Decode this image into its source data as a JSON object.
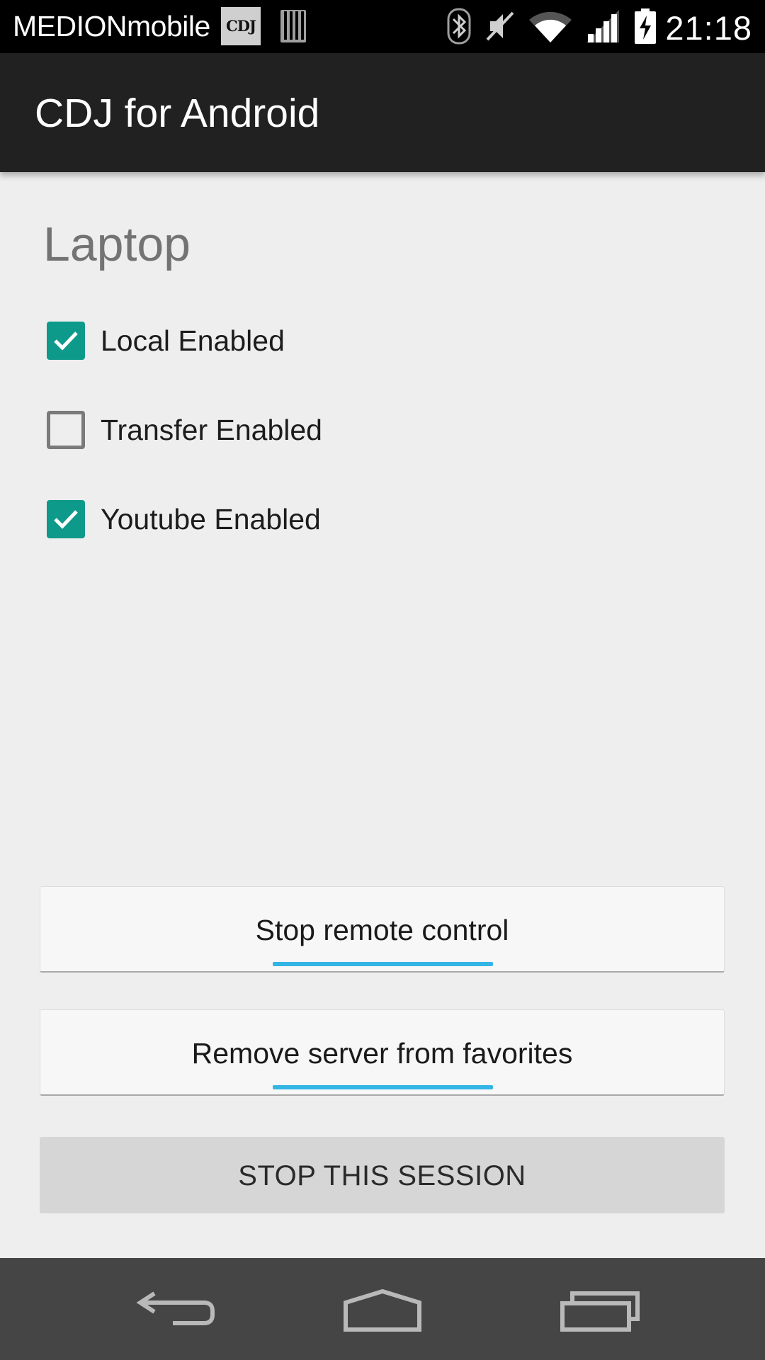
{
  "status_bar": {
    "carrier": "MEDIONmobile",
    "app_notification_icon_text": "CDJ",
    "time": "21:18",
    "icons": [
      "app-notification-icon",
      "sd-card-icon",
      "bluetooth-icon",
      "muted-icon",
      "wifi-icon",
      "cell-signal-icon",
      "battery-charging-icon"
    ]
  },
  "action_bar": {
    "title": "CDJ for Android"
  },
  "main": {
    "section_title": "Laptop",
    "options": [
      {
        "label": "Local Enabled",
        "checked": true
      },
      {
        "label": "Transfer Enabled",
        "checked": false
      },
      {
        "label": "Youtube Enabled",
        "checked": true
      }
    ],
    "buttons": {
      "stop_remote": "Stop remote control",
      "remove_favorite": "Remove server from favorites",
      "stop_session": "STOP THIS SESSION"
    }
  },
  "nav_bar": {
    "icons": [
      "back-icon",
      "home-icon",
      "recent-apps-icon"
    ]
  },
  "colors": {
    "accent": "#0d9a8a",
    "focus_underline": "#33b5e5",
    "action_bar": "#212121",
    "background": "#eeeeee"
  }
}
